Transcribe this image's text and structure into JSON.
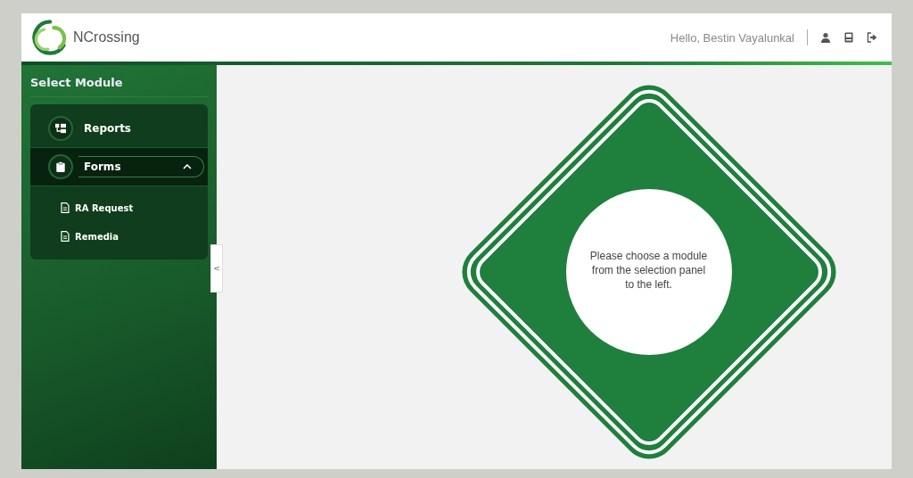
{
  "header": {
    "app_name": "NCrossing",
    "greeting": "Hello, Bestin Vayalunkal"
  },
  "sidebar": {
    "title": "Select Module",
    "items": [
      {
        "label": "Reports",
        "kind": "module",
        "selected": false,
        "expanded": false
      },
      {
        "label": "Forms",
        "kind": "module",
        "selected": true,
        "expanded": true,
        "children": [
          {
            "label": "RA Request"
          },
          {
            "label": "Remedia"
          }
        ]
      }
    ],
    "collapse_label": "<"
  },
  "main": {
    "message": "Please choose a module from the selection panel to the left."
  }
}
